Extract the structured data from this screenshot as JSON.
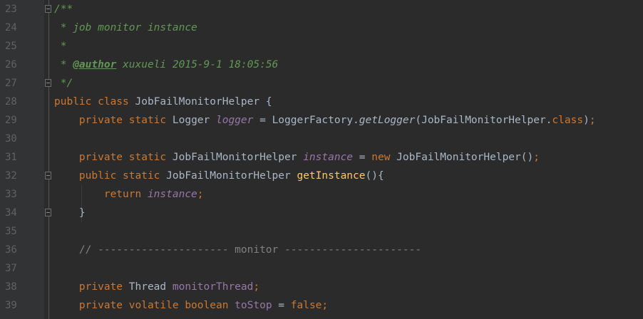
{
  "lines": [
    {
      "number": "23",
      "tokens": [
        {
          "t": "/**",
          "c": "com"
        }
      ]
    },
    {
      "number": "24",
      "tokens": [
        {
          "t": " * job monitor instance",
          "c": "com"
        }
      ]
    },
    {
      "number": "25",
      "tokens": [
        {
          "t": " *",
          "c": "com"
        }
      ]
    },
    {
      "number": "26",
      "tokens": [
        {
          "t": " * ",
          "c": "com"
        },
        {
          "t": "@author",
          "c": "tag"
        },
        {
          "t": " xuxueli 2015-9-1 18:05:56",
          "c": "com"
        }
      ]
    },
    {
      "number": "27",
      "tokens": [
        {
          "t": " */",
          "c": "com"
        }
      ]
    },
    {
      "number": "28",
      "tokens": [
        {
          "t": "public class ",
          "c": "kw"
        },
        {
          "t": "JobFailMonitorHelper {",
          "c": "txt"
        }
      ]
    },
    {
      "number": "29",
      "tokens": [
        {
          "t": "    private static ",
          "c": "kw"
        },
        {
          "t": "Logger ",
          "c": "txt"
        },
        {
          "t": "logger",
          "c": "sfield"
        },
        {
          "t": " = LoggerFactory.",
          "c": "txt"
        },
        {
          "t": "getLogger",
          "c": "smeth"
        },
        {
          "t": "(JobFailMonitorHelper.",
          "c": "txt"
        },
        {
          "t": "class",
          "c": "kw"
        },
        {
          "t": ")",
          "c": "txt"
        },
        {
          "t": ";",
          "c": "kw"
        }
      ]
    },
    {
      "number": "30",
      "tokens": []
    },
    {
      "number": "31",
      "tokens": [
        {
          "t": "    private static ",
          "c": "kw"
        },
        {
          "t": "JobFailMonitorHelper ",
          "c": "txt"
        },
        {
          "t": "instance",
          "c": "sfield"
        },
        {
          "t": " = ",
          "c": "txt"
        },
        {
          "t": "new ",
          "c": "kw"
        },
        {
          "t": "JobFailMonitorHelper()",
          "c": "txt"
        },
        {
          "t": ";",
          "c": "kw"
        }
      ]
    },
    {
      "number": "32",
      "tokens": [
        {
          "t": "    public static ",
          "c": "kw"
        },
        {
          "t": "JobFailMonitorHelper ",
          "c": "txt"
        },
        {
          "t": "getInstance",
          "c": "meth"
        },
        {
          "t": "(){",
          "c": "txt"
        }
      ]
    },
    {
      "number": "33",
      "tokens": [
        {
          "t": "        return ",
          "c": "kw"
        },
        {
          "t": "instance",
          "c": "sfield"
        },
        {
          "t": ";",
          "c": "kw"
        }
      ]
    },
    {
      "number": "34",
      "tokens": [
        {
          "t": "    }",
          "c": "txt"
        }
      ]
    },
    {
      "number": "35",
      "tokens": []
    },
    {
      "number": "36",
      "tokens": [
        {
          "t": "    // --------------------- monitor ----------------------",
          "c": "line-com"
        }
      ]
    },
    {
      "number": "37",
      "tokens": []
    },
    {
      "number": "38",
      "tokens": [
        {
          "t": "    private ",
          "c": "kw"
        },
        {
          "t": "Thread ",
          "c": "txt"
        },
        {
          "t": "monitorThread",
          "c": "field"
        },
        {
          "t": ";",
          "c": "kw"
        }
      ]
    },
    {
      "number": "39",
      "tokens": [
        {
          "t": "    private volatile boolean ",
          "c": "kw"
        },
        {
          "t": "toStop",
          "c": "field"
        },
        {
          "t": " = ",
          "c": "txt"
        },
        {
          "t": "false",
          "c": "kw"
        },
        {
          "t": ";",
          "c": "kw"
        }
      ]
    }
  ],
  "fold_markers": [
    "23",
    "27",
    "32",
    "34"
  ],
  "colors": {
    "background": "#2b2b2b",
    "gutter": "#313335",
    "keyword": "#cc7832",
    "doc_comment": "#629755",
    "line_comment": "#808080",
    "field": "#9876aa",
    "method": "#ffc66d",
    "text": "#a9b7c6",
    "line_number": "#606366"
  }
}
